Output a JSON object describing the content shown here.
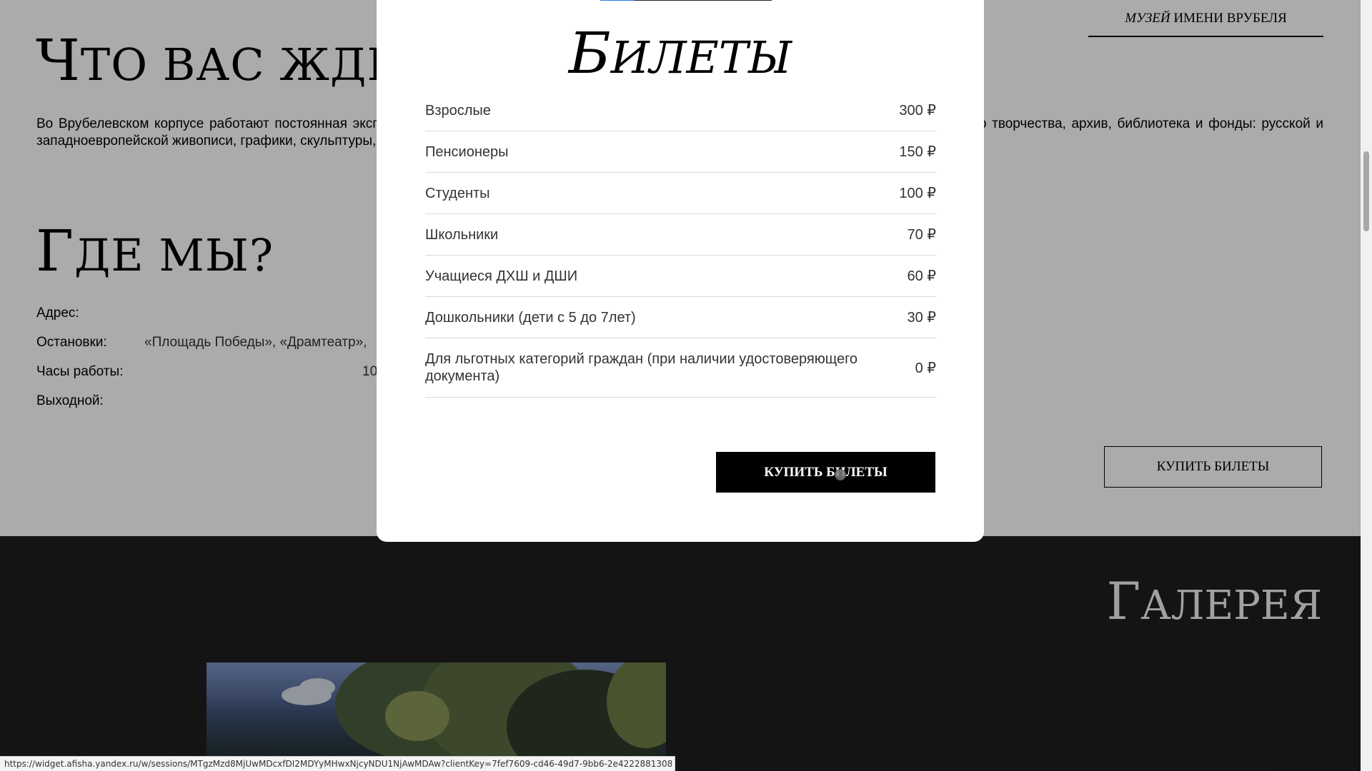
{
  "header": {
    "museum_link": {
      "part1": "МУЗЕЙ",
      "part2": "ИМЕНИ ВРУБЕЛЯ"
    }
  },
  "what_awaits": {
    "title_first": "Ч",
    "title_rest": "ТО ВАС ЖДЁТ",
    "description": "Во Врубелевском корпусе работают постоянная экспозиция, выставочные залы, реставрационные мастерские, отдел музейной педагогики, Центр творчества, архив, библиотека и фонды: русской и западноевропейской живописи, графики, скульптуры, декоративно-прикладного искусства, редкой книги."
  },
  "where": {
    "title_first": "Г",
    "title_rest": "ДЕ МЫ?",
    "rows": [
      {
        "label": "Адрес:",
        "value": ""
      },
      {
        "label": "Остановки:",
        "value": "«Площадь Победы», «Драмтеатр», "
      },
      {
        "label": "Часы работы:",
        "value": "10"
      },
      {
        "label": "Выходной:",
        "value": ""
      }
    ]
  },
  "buy_outline_label": "КУПИТЬ БИЛЕТЫ",
  "gallery": {
    "title_first": "Г",
    "title_rest": "АЛЕРЕЯ"
  },
  "modal": {
    "title_first": "Б",
    "title_rest": "ИЛЕТЫ",
    "prices": [
      {
        "category": "Взрослые",
        "price": "300 ₽"
      },
      {
        "category": "Пенсионеры",
        "price": "150 ₽"
      },
      {
        "category": "Студенты",
        "price": "100 ₽"
      },
      {
        "category": "Школьники",
        "price": "70 ₽"
      },
      {
        "category": "Учащиеся ДХШ и ДШИ",
        "price": "60 ₽"
      },
      {
        "category": "Дошкольники (дети с 5 до 7лет)",
        "price": "30 ₽"
      },
      {
        "category": "Для льготных категорий граждан (при наличии удостоверяющего документа)",
        "price": "0 ₽"
      }
    ],
    "buy_label": "КУПИТЬ БИЛЕТЫ"
  },
  "status_url": "https://widget.afisha.yandex.ru/w/sessions/MTgzMzd8MjUwMDcxfDI2MDYyMHwxNjcyNDU1NjAwMDAw?clientKey=7fef7609-cd46-49d7-9bb6-2e4222881308"
}
